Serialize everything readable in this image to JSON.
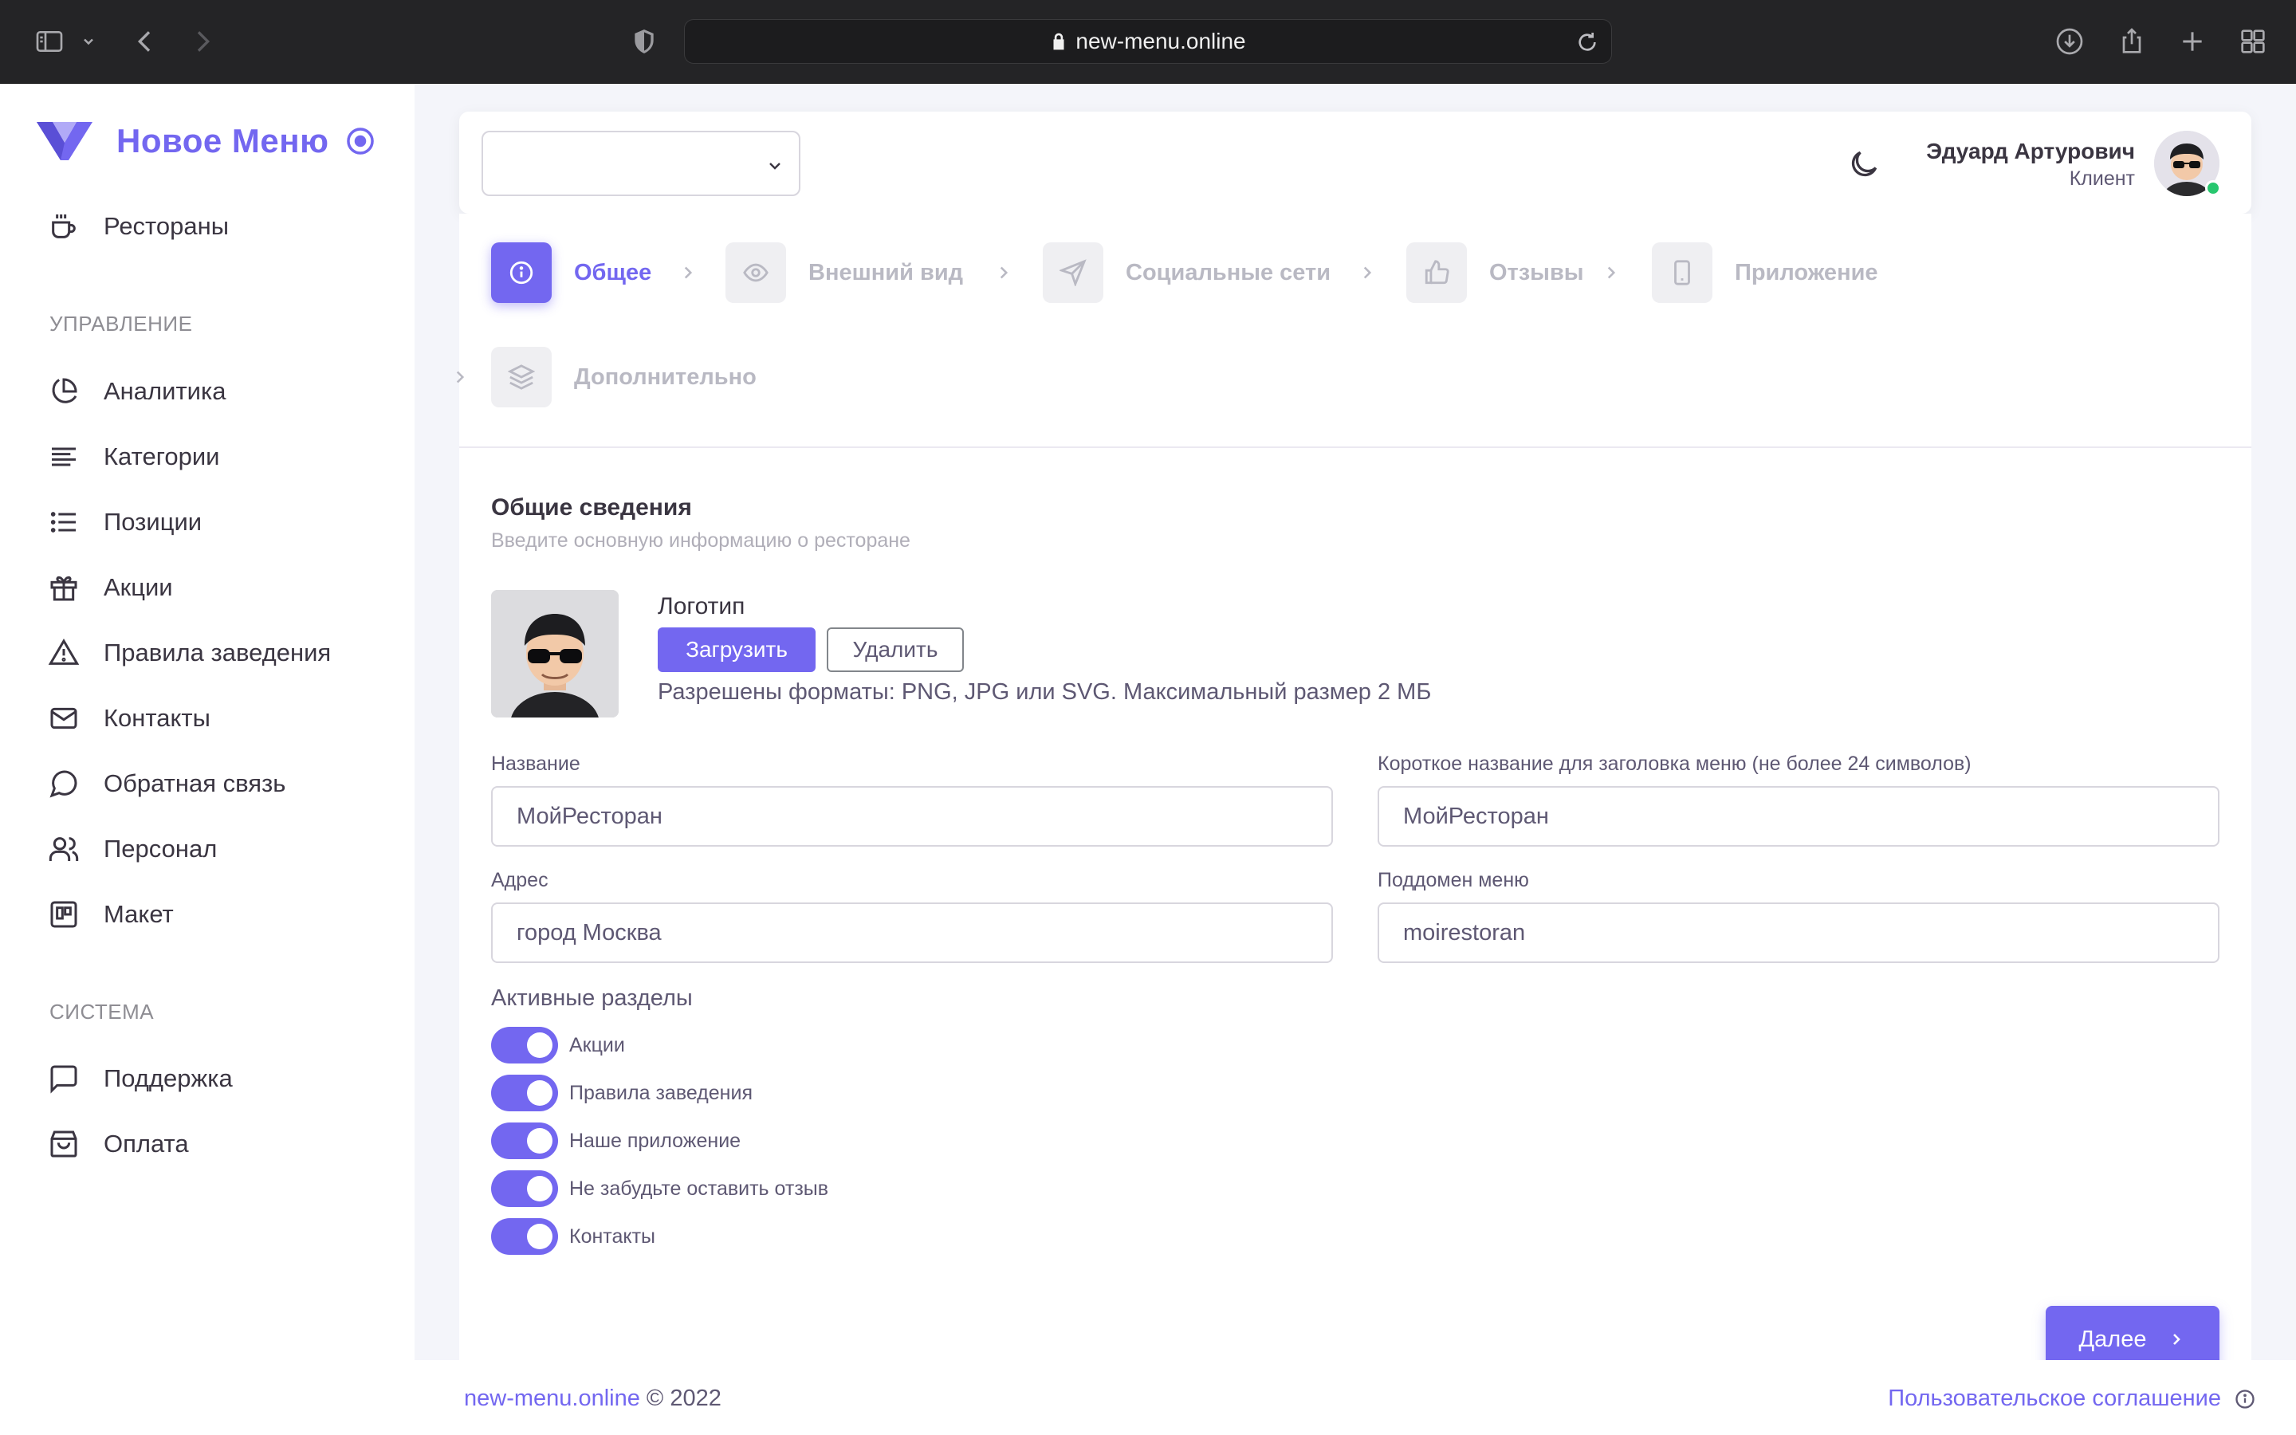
{
  "browser": {
    "url": "new-menu.online"
  },
  "brand": {
    "name": "Новое Меню",
    "accent": "#7367f0"
  },
  "sidebar": {
    "top_item": {
      "label": "Рестораны",
      "icon": "coffee-cup-icon"
    },
    "section_manage": "УПРАВЛЕНИЕ",
    "manage_items": [
      {
        "label": "Аналитика",
        "icon": "pie-chart-icon"
      },
      {
        "label": "Категории",
        "icon": "align-left-icon"
      },
      {
        "label": "Позиции",
        "icon": "list-icon"
      },
      {
        "label": "Акции",
        "icon": "gift-icon"
      },
      {
        "label": "Правила заведения",
        "icon": "alert-triangle-icon"
      },
      {
        "label": "Контакты",
        "icon": "mail-icon"
      },
      {
        "label": "Обратная связь",
        "icon": "message-circle-icon"
      },
      {
        "label": "Персонал",
        "icon": "users-icon"
      },
      {
        "label": "Макет",
        "icon": "layout-icon"
      }
    ],
    "section_system": "СИСТЕМА",
    "system_items": [
      {
        "label": "Поддержка",
        "icon": "message-square-icon"
      },
      {
        "label": "Оплата",
        "icon": "shopping-bag-icon"
      }
    ]
  },
  "header": {
    "restaurant_select_value": "",
    "user_name": "Эдуард Артурович",
    "user_role": "Клиент",
    "online_color": "#28c76f"
  },
  "steps": [
    {
      "label": "Общее",
      "icon": "info-icon",
      "active": true
    },
    {
      "label": "Внешний вид",
      "icon": "eye-icon",
      "active": false
    },
    {
      "label": "Социальные сети",
      "icon": "send-icon",
      "active": false
    },
    {
      "label": "Отзывы",
      "icon": "thumbs-up-icon",
      "active": false
    },
    {
      "label": "Приложение",
      "icon": "smartphone-icon",
      "active": false
    },
    {
      "label": "Дополнительно",
      "icon": "layers-icon",
      "active": false
    }
  ],
  "form": {
    "title": "Общие сведения",
    "subtitle": "Введите основную информацию о ресторане",
    "logo": {
      "title": "Логотип",
      "upload_label": "Загрузить",
      "delete_label": "Удалить",
      "hint": "Разрешены форматы: PNG, JPG или SVG. Максимальный размер 2 МБ"
    },
    "name_label": "Название",
    "name_value": "МойРесторан",
    "short_name_label": "Короткое название для заголовка меню (не более 24 символов)",
    "short_name_value": "МойРесторан",
    "address_label": "Адрес",
    "address_value": "город Москва",
    "subdomain_label": "Поддомен меню",
    "subdomain_value": "moirestoran",
    "sections_title": "Активные разделы",
    "sections": [
      {
        "label": "Акции",
        "enabled": true
      },
      {
        "label": "Правила заведения",
        "enabled": true
      },
      {
        "label": "Наше приложение",
        "enabled": true
      },
      {
        "label": "Не забудьте оставить отзыв",
        "enabled": true
      },
      {
        "label": "Контакты",
        "enabled": true
      }
    ],
    "next_label": "Далее"
  },
  "footer": {
    "site": "new-menu.online",
    "copyright": "© 2022",
    "agreement": "Пользовательское соглашение"
  }
}
